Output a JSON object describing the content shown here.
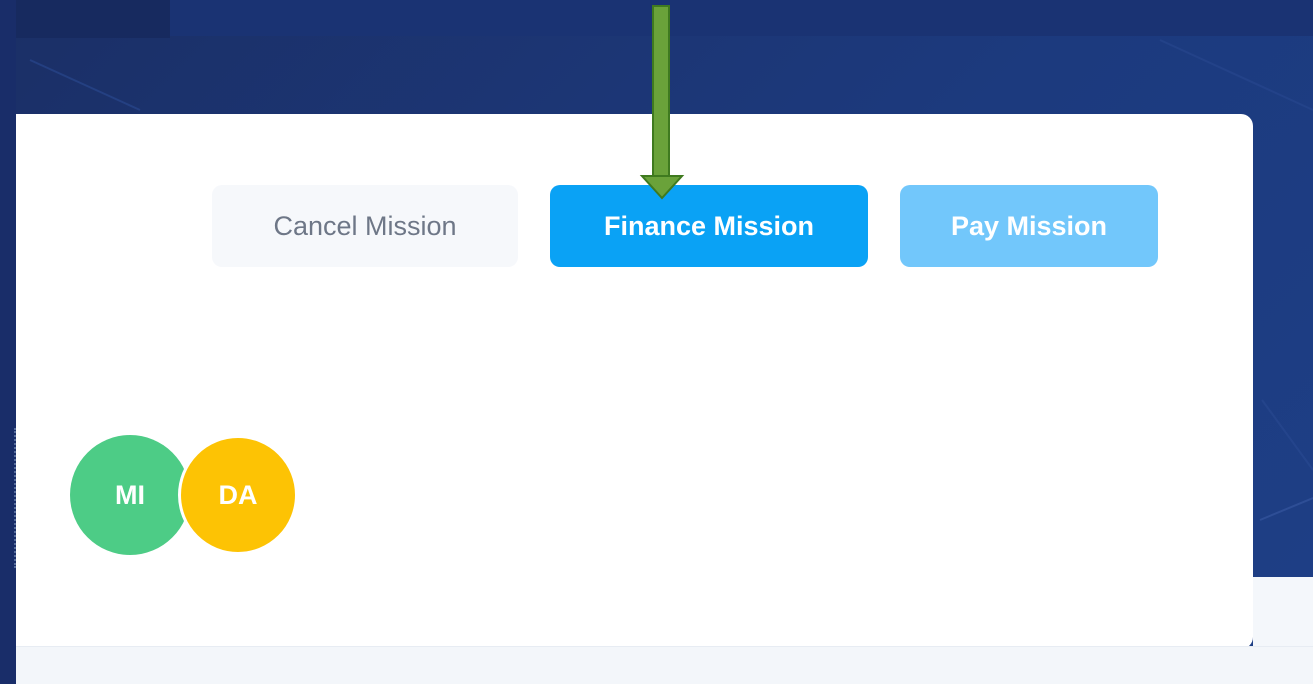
{
  "actions": {
    "cancel_label": "Cancel Mission",
    "finance_label": "Finance Mission",
    "pay_label": "Pay Mission"
  },
  "participants": [
    {
      "initials": "MI",
      "color": "#4dcc86"
    },
    {
      "initials": "DA",
      "color": "#fdc304"
    }
  ],
  "colors": {
    "background": "#1c3a7e",
    "card": "#ffffff",
    "primary_button": "#0aa2f5",
    "disabled_button": "#72c7fb",
    "secondary_button": "#f6f8fb",
    "annotation_arrow": "#6aa23a"
  },
  "annotation": {
    "icon": "arrow-down-icon",
    "points_to": "finance-mission-button"
  }
}
